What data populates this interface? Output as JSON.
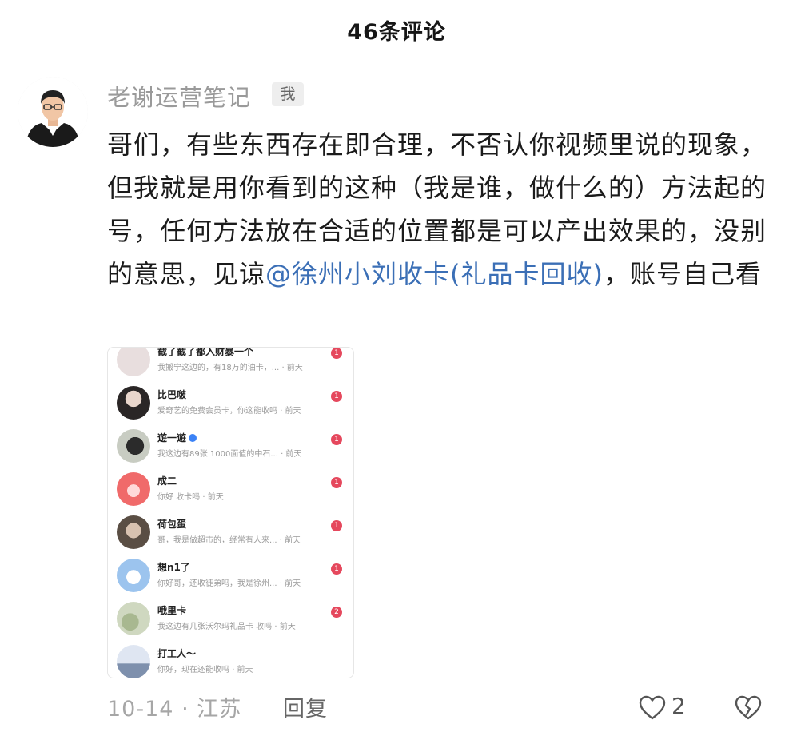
{
  "header": {
    "title": "46条评论"
  },
  "comment": {
    "author": "老谢运营笔记",
    "author_badge": "我",
    "body_text": "哥们，有些东西存在即合理，不否认你视频里说的现象，但我就是用你看到的这种（我是谁，做什么的）方法起的号，任何方法放在合适的位置都是可以产出效果的，没别的意思，见谅",
    "mention": "@徐州小刘收卡(礼品卡回收)",
    "body_tail": "，账号自己看",
    "date": "10-14",
    "location": "江苏",
    "meta_sep": "·",
    "reply_label": "回复",
    "like_count": "2"
  },
  "screenshot": {
    "messages": [
      {
        "name": "截了截了都入财暴一个",
        "preview": "我搬宁这边的，有18万的油卡，...",
        "time": "· 前天",
        "badge": "1",
        "avatar_color": "#e8dede"
      },
      {
        "name": "比巴啵",
        "preview": "爱奇艺的免费会员卡，你这能收吗",
        "time": "· 前天",
        "badge": "1",
        "avatar_color": "#2a2626"
      },
      {
        "name": "遊一遊",
        "preview": "我这边有89张 1000面值的中石...",
        "time": "· 前天",
        "badge": "1",
        "avatar_color": "#c8ccc2"
      },
      {
        "name": "成二",
        "preview": "你好 收卡吗",
        "time": "· 前天",
        "badge": "1",
        "avatar_color": "#f06a6a"
      },
      {
        "name": "荷包蛋",
        "preview": "哥，我是做超市的，经常有人来...",
        "time": "· 前天",
        "badge": "1",
        "avatar_color": "#5a4e44"
      },
      {
        "name": "想n1了",
        "preview": "你好哥，还收徒弟吗，我是徐州...",
        "time": "· 前天",
        "badge": "1",
        "avatar_color": "#9cc4ee"
      },
      {
        "name": "哦里卡",
        "preview": "我这边有几张沃尔玛礼品卡 收吗",
        "time": "· 前天",
        "badge": "2",
        "avatar_color": "#cfd8c0"
      },
      {
        "name": "打工人～",
        "preview": "你好，现在还能收吗",
        "time": "· 前天",
        "badge": "",
        "avatar_color": "#b6c4dc"
      }
    ]
  },
  "colors": {
    "mention": "#3b6fb6",
    "badge": "#e5485d",
    "meta": "#a6a6a6"
  },
  "icons": [
    "heart-outline-icon",
    "broken-heart-icon",
    "verified-icon"
  ]
}
